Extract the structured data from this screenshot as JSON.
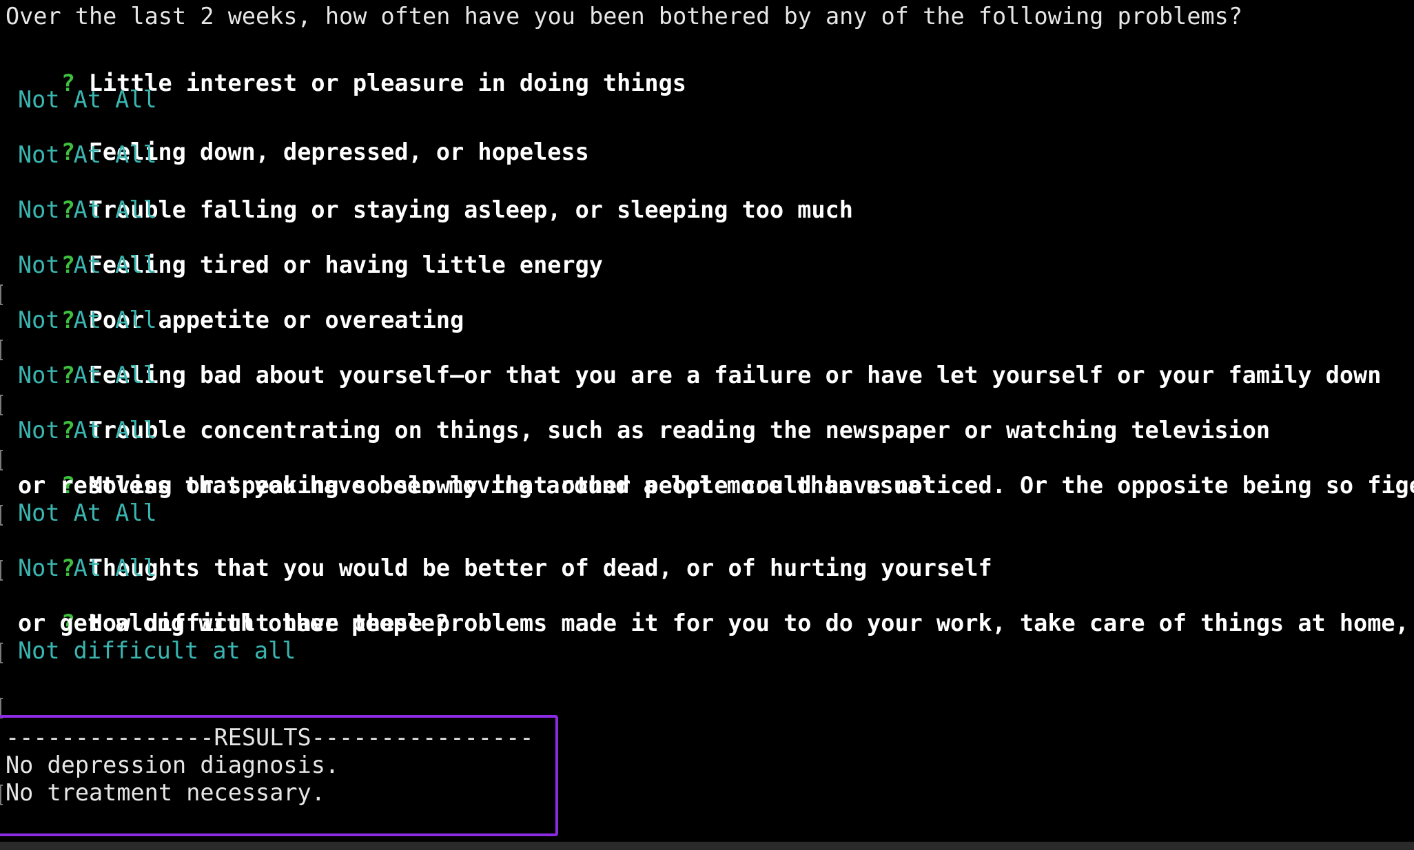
{
  "intro": "Over the last 2 weeks, how often have you been bothered by any of the following problems?",
  "prompt_symbol": "?",
  "questions": [
    {
      "lines": [
        "Little interest or pleasure in doing things"
      ],
      "answer": "Not At All"
    },
    {
      "lines": [
        "Feeling down, depressed, or hopeless"
      ],
      "answer": "Not At All"
    },
    {
      "lines": [
        "Trouble falling or staying asleep, or sleeping too much"
      ],
      "answer": "Not At All"
    },
    {
      "lines": [
        "Feeling tired or having little energy"
      ],
      "answer": "Not At All"
    },
    {
      "lines": [
        "Poor appetite or overeating"
      ],
      "answer": "Not At All"
    },
    {
      "lines": [
        "Feeling bad about yourself—or that you are a failure or have let yourself or your family down"
      ],
      "answer": "Not At All"
    },
    {
      "lines": [
        "Trouble concentrating on things, such as reading the newspaper or watching television"
      ],
      "answer": "Not At All"
    },
    {
      "lines": [
        "Moving or speaking so slowly that other people could have noticed. Or the opposite being so figety",
        "or restless that you have been moving around a lot more than usual"
      ],
      "answer": "Not At All"
    },
    {
      "lines": [
        "Thoughts that you would be better of dead, or of hurting yourself"
      ],
      "answer": "Not At All"
    },
    {
      "lines": [
        "How difficult have these problems made it for you to do your work, take care of things at home,",
        "or get along with other people?"
      ],
      "answer": "Not difficult at all"
    }
  ],
  "results": {
    "header": "---------------RESULTS----------------",
    "diagnosis": "No depression diagnosis.",
    "treatment": "No treatment necessary."
  },
  "colors": {
    "background": "#000000",
    "question_mark": "#3fbf3f",
    "answer": "#3ab5b0",
    "question_text": "#ffffff",
    "results_border": "#8a2be2"
  }
}
